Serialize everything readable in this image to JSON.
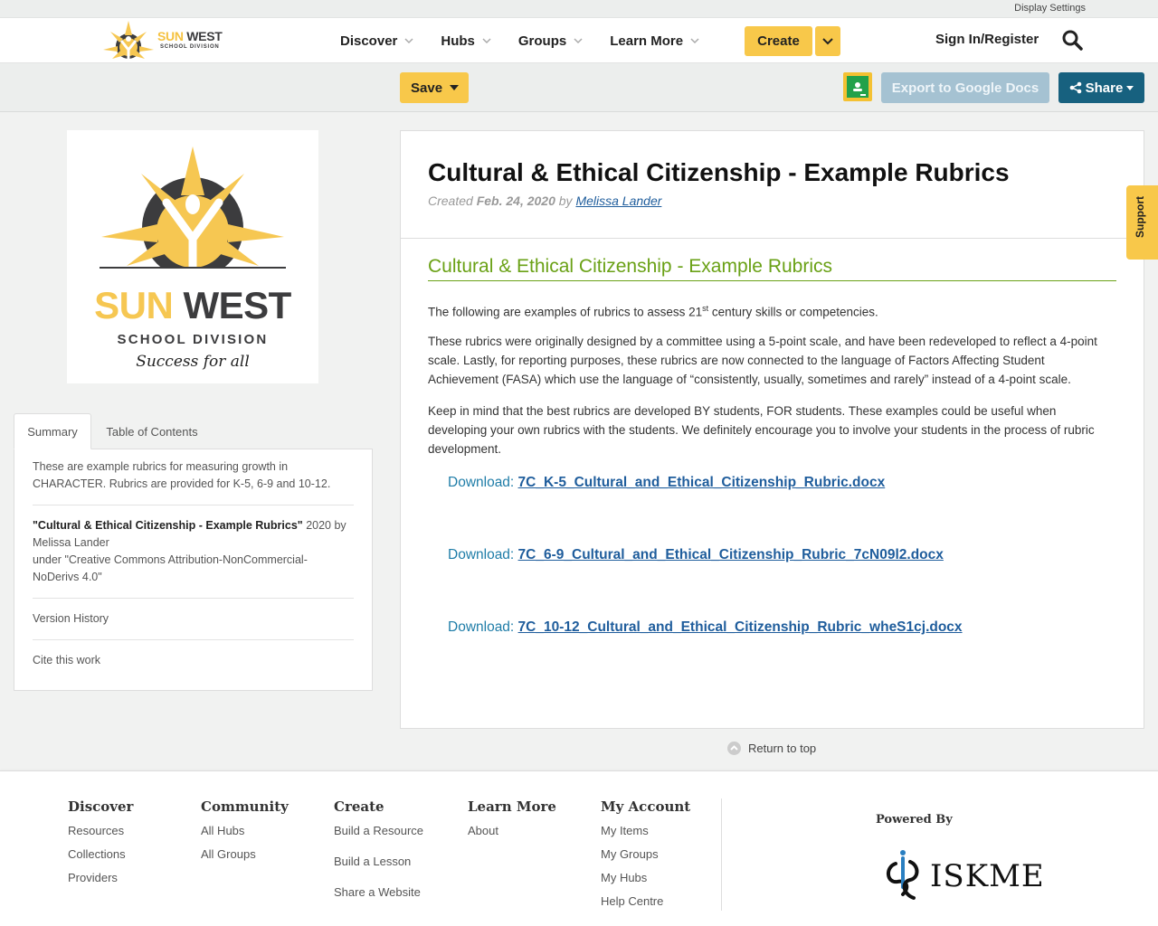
{
  "topbar": {
    "display_settings": "Display Settings"
  },
  "brand": {
    "sun": "SUN",
    "west": "WEST",
    "school_division": "SCHOOL DIVISION",
    "tagline": "Success for all"
  },
  "nav": {
    "items": [
      {
        "label": "Discover"
      },
      {
        "label": "Hubs"
      },
      {
        "label": "Groups"
      },
      {
        "label": "Learn More"
      }
    ],
    "create": "Create",
    "signin": "Sign In/Register"
  },
  "toolbar": {
    "save": "Save",
    "export": "Export to Google Docs",
    "share": "Share"
  },
  "sidebar": {
    "tabs": [
      {
        "label": "Summary"
      },
      {
        "label": "Table of Contents"
      }
    ],
    "summary": "These are example rubrics for measuring growth in CHARACTER. Rubrics are provided for K-5, 6-9 and 10-12.",
    "attribution_title": "\"Cultural & Ethical Citizenship - Example Rubrics\"",
    "attribution_year_by": " 2020 by",
    "attribution_author": "Melissa Lander",
    "attribution_license": "under \"Creative Commons Attribution-NonCommercial-NoDerivs 4.0\"",
    "version_history": "Version History",
    "cite": "Cite this work"
  },
  "content": {
    "title": "Cultural & Ethical Citizenship - Example Rubrics",
    "created_label": "Created",
    "created_date": "Feb. 24, 2020",
    "by_label": "by",
    "author": "Melissa Lander",
    "heading": "Cultural & Ethical Citizenship - Example Rubrics",
    "p1_before": "The following are examples of rubrics to assess 21",
    "p1_sup": "st",
    "p1_after": " century skills or competencies.",
    "p2": "These rubrics were originally designed by a committee using a 5-point scale, and have been redeveloped to reflect a 4-point scale.  Lastly, for reporting purposes, these rubrics are now connected to the language of Factors Affecting Student Achievement (FASA) which use the language of “consistently, usually, sometimes and rarely” instead of a 4-point scale.",
    "p3": "Keep in mind that the best rubrics are developed BY students, FOR students.  These examples could be useful when developing your own rubrics with the students.  We definitely encourage you to involve your students in the process of rubric development.",
    "download_label": "Download: ",
    "downloads": [
      {
        "file": "7C_K-5_Cultural_and_Ethical_Citizenship_Rubric.docx"
      },
      {
        "file": "7C_6-9_Cultural_and_Ethical_Citizenship_Rubric_7cN09l2.docx"
      },
      {
        "file": "7C_10-12_Cultural_and_Ethical_Citizenship_Rubric_wheS1cj.docx"
      }
    ]
  },
  "return_top": "Return to top",
  "support": "Support",
  "footer": {
    "discover": {
      "heading": "Discover",
      "links": [
        "Resources",
        "Collections",
        "Providers"
      ]
    },
    "community": {
      "heading": "Community",
      "links": [
        "All Hubs",
        "All Groups"
      ]
    },
    "create": {
      "heading": "Create",
      "links": [
        "Build a Resource",
        "Build a Lesson",
        "Share a Website"
      ]
    },
    "learn_more": {
      "heading": "Learn More",
      "links": [
        "About"
      ]
    },
    "my_account": {
      "heading": "My Account",
      "links": [
        "My Items",
        "My Groups",
        "My Hubs",
        "Help Centre"
      ]
    },
    "powered_by": "Powered By",
    "iskme": "ISKME"
  },
  "colors": {
    "accent_yellow": "#f8c84a",
    "share_blue": "#17617f",
    "export_disabled": "#a5c2d2",
    "heading_green": "#6aa116",
    "link_blue": "#1f5d9c"
  }
}
